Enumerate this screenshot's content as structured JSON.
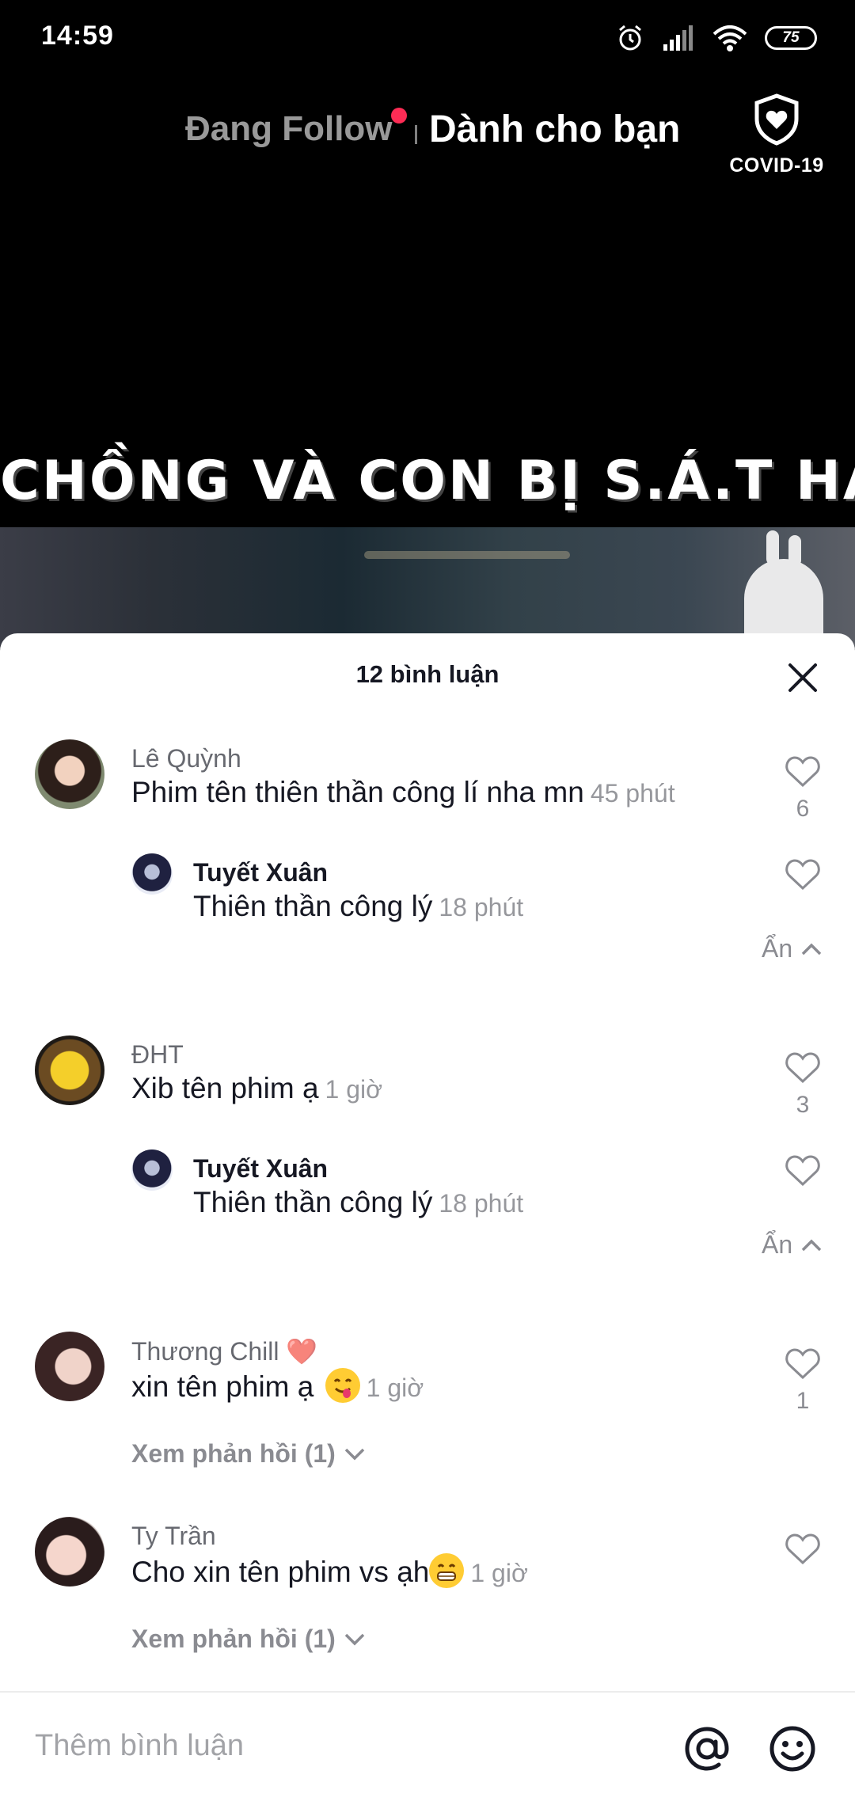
{
  "status_bar": {
    "time": "14:59",
    "battery": "75",
    "icons": [
      "alarm-icon",
      "signal-icon",
      "wifi-icon",
      "battery-icon"
    ]
  },
  "top_tabs": {
    "following": "Đang Follow",
    "for_you": "Dành cho bạn",
    "covid_label": "COVID-19"
  },
  "video": {
    "caption": "CHỒNG VÀ CON BỊ S.Á.T HẠI"
  },
  "comments_panel": {
    "header": "12 bình luận",
    "comments": [
      {
        "user": "Lê Quỳnh",
        "text": "Phim tên thiên thần công lí nha mn",
        "time": "45 phút",
        "likes": "6",
        "reply": {
          "user": "Tuyết Xuân",
          "text": "Thiên thần công lý",
          "time": "18 phút"
        },
        "toggle": "Ẩn"
      },
      {
        "user": "ĐHT",
        "text": "Xib tên phim ạ",
        "time": "1 giờ",
        "likes": "3",
        "reply": {
          "user": "Tuyết Xuân",
          "text": "Thiên thần công lý",
          "time": "18 phút"
        },
        "toggle": "Ẩn"
      },
      {
        "user": "Thương Chill ❤️",
        "text": "xin tên phim ạ",
        "time": "1 giờ",
        "likes": "1",
        "view_replies": "Xem phản hồi (1)"
      },
      {
        "user": "Ty Trần",
        "text": "Cho xin tên phim vs ạh",
        "time": "1 giờ",
        "likes": "",
        "view_replies": "Xem phản hồi (1)"
      }
    ],
    "input_placeholder": "Thêm bình luận"
  },
  "colors": {
    "accent": "#fe2c55",
    "text_primary": "#161823",
    "sheet_bg": "#ffffff"
  }
}
